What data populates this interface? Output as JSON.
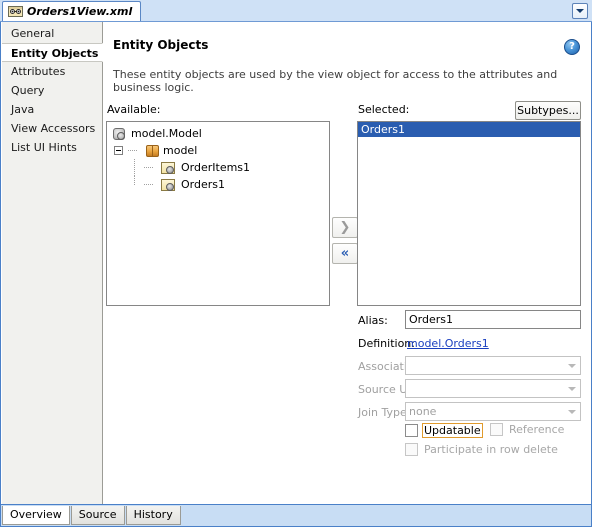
{
  "window": {
    "file_tab": {
      "label": "Orders1View.xml",
      "icon": "xml-view-file-icon"
    },
    "tab_dropdown_icon": "chevron-down-icon"
  },
  "sidebar": {
    "items": [
      {
        "label": "General",
        "selected": false
      },
      {
        "label": "Entity Objects",
        "selected": true
      },
      {
        "label": "Attributes",
        "selected": false
      },
      {
        "label": "Query",
        "selected": false
      },
      {
        "label": "Java",
        "selected": false
      },
      {
        "label": "View Accessors",
        "selected": false
      },
      {
        "label": "List UI Hints",
        "selected": false
      }
    ]
  },
  "main": {
    "title": "Entity Objects",
    "description": "These entity objects are used by the view object for access to the attributes and business logic.",
    "help_icon": "help-question-icon",
    "help_glyph": "?",
    "available": {
      "label": "Available:",
      "tree": [
        {
          "label": "model.Model",
          "icon": "model-root-icon",
          "level": 0
        },
        {
          "label": "model",
          "icon": "package-icon",
          "level": 1
        },
        {
          "label": "OrderItems1",
          "icon": "entity-object-icon",
          "level": 2
        },
        {
          "label": "Orders1",
          "icon": "entity-object-icon",
          "level": 2
        }
      ]
    },
    "selected": {
      "label": "Selected:",
      "items": [
        {
          "label": "Orders1",
          "selected": true
        }
      ]
    },
    "subtypes_button": "Subtypes...",
    "transfer": {
      "add_icon": "chevron-right-icon",
      "add_glyph": "❯",
      "add_enabled": false,
      "remove_icon": "chevron-double-left-icon",
      "remove_glyph": "«",
      "remove_enabled": true
    },
    "form": {
      "alias_label": "Alias:",
      "alias_value": "Orders1",
      "definition_label": "Definition:",
      "definition_value": "model.Orders1",
      "association_label": "Association:",
      "association_value": "",
      "source_usage_label": "Source Usage:",
      "source_usage_value": "",
      "join_type_label": "Join Type:",
      "join_type_value": "none",
      "updatable_label": "Updatable",
      "updatable_checked": false,
      "reference_label": "Reference",
      "reference_checked": false,
      "participate_label": "Participate in row delete",
      "participate_checked": false
    }
  },
  "bottom_tabs": [
    {
      "label": "Overview",
      "active": true
    },
    {
      "label": "Source",
      "active": false
    },
    {
      "label": "History",
      "active": false
    }
  ],
  "colors": {
    "accent_blue": "#2a5db0",
    "link_blue": "#1a3fbf",
    "frame_blue": "#4a80c8",
    "focus_orange": "#e09b2e"
  }
}
